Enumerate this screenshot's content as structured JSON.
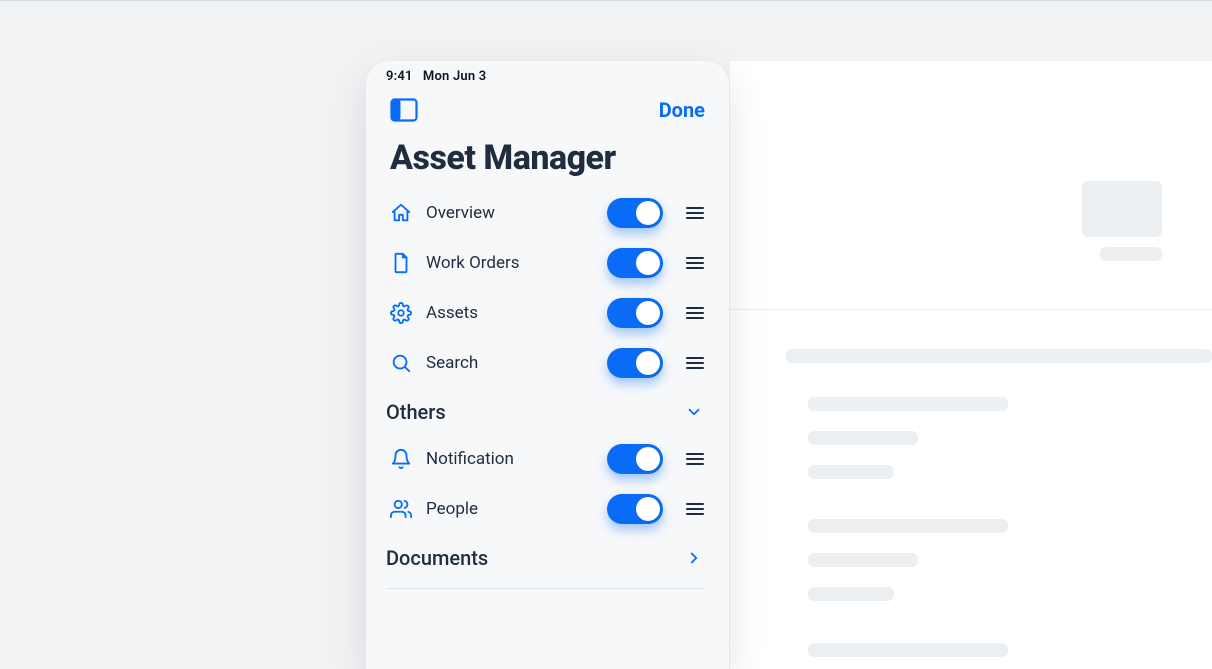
{
  "status": {
    "time": "9:41",
    "date": "Mon Jun 3"
  },
  "header": {
    "done_label": "Done"
  },
  "title": "Asset Manager",
  "sections": [
    {
      "id": "main",
      "items": [
        {
          "icon": "home-icon",
          "label": "Overview",
          "enabled": true
        },
        {
          "icon": "clipboard-icon",
          "label": "Work Orders",
          "enabled": true
        },
        {
          "icon": "gear-icon",
          "label": "Assets",
          "enabled": true
        },
        {
          "icon": "search-icon",
          "label": "Search",
          "enabled": true
        }
      ]
    },
    {
      "id": "others",
      "label": "Others",
      "collapsed": false,
      "items": [
        {
          "icon": "bell-icon",
          "label": "Notification",
          "enabled": true
        },
        {
          "icon": "people-icon",
          "label": "People",
          "enabled": true
        }
      ]
    },
    {
      "id": "documents",
      "label": "Documents",
      "collapsed": true,
      "items": []
    }
  ],
  "colors": {
    "accent": "#0a6cf6",
    "text": "#1f2d3f"
  }
}
